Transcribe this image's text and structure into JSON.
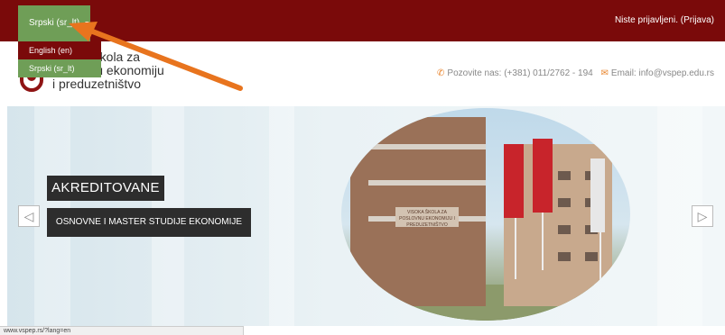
{
  "topbar": {
    "language_toggle": "Srpski (sr_lt)",
    "login_text": "Niste prijavljeni.",
    "login_link": "(Prijava)"
  },
  "language_menu": {
    "options": [
      "English (en)",
      "Srpski (sr_lt)"
    ],
    "selected": "Srpski (sr_lt)"
  },
  "header": {
    "school_name_lines": [
      "Visoka škola za",
      "poslovnu ekonomiju",
      "i preduzetništvo"
    ],
    "phone_label": "Pozovite nas: (+381) 011/2762 - 194",
    "email_label": "Email: info@vspep.edu.rs",
    "phone_icon": "phone-icon",
    "email_icon": "envelope-icon"
  },
  "hero": {
    "caption_title": "AKREDITOVANE",
    "caption_subtitle": "OSNOVNE I MASTER STUDIJE EKONOMIJE",
    "building_sign": "VISOKA ŠKOLA ZA POSLOVNU EKONOMIJU I PREDUZETNIŠTVO",
    "prev_icon": "chevron-left-icon",
    "next_icon": "chevron-right-icon"
  },
  "status_bar": {
    "url": "www.vspep.rs/?lang=en"
  },
  "colors": {
    "topbar": "#7a0a0a",
    "accent_green": "#6f9e57",
    "annotation_arrow": "#e8741e"
  }
}
